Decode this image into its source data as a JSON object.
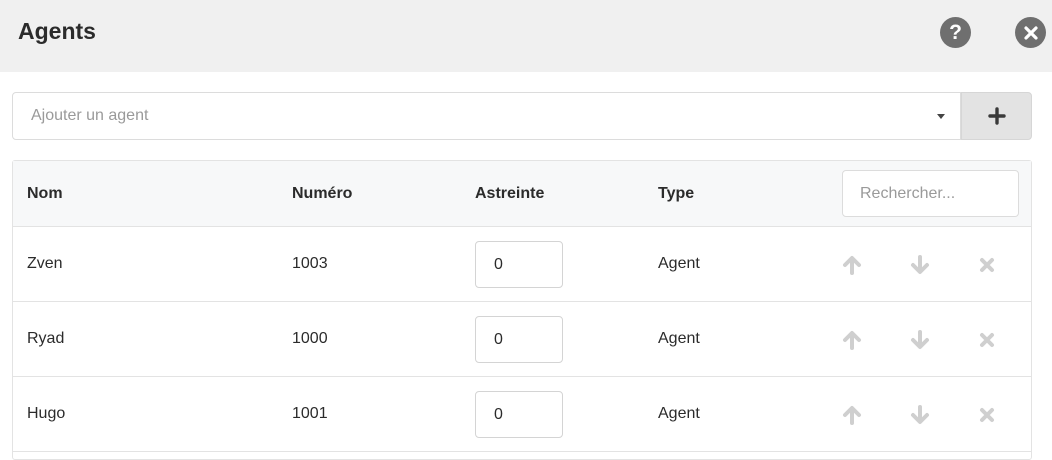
{
  "header": {
    "title": "Agents",
    "help_glyph": "?"
  },
  "agent_select": {
    "placeholder": "Ajouter un agent"
  },
  "table": {
    "columns": {
      "name": "Nom",
      "number": "Numéro",
      "astreinte": "Astreinte",
      "type": "Type"
    },
    "search_placeholder": "Rechercher...",
    "rows": [
      {
        "name": "Zven",
        "number": "1003",
        "astreinte": "0",
        "type": "Agent"
      },
      {
        "name": "Ryad",
        "number": "1000",
        "astreinte": "0",
        "type": "Agent"
      },
      {
        "name": "Hugo",
        "number": "1001",
        "astreinte": "0",
        "type": "Agent"
      }
    ]
  },
  "colors": {
    "header_bg": "#f0f0f0",
    "icon_grey": "#6f6f6f",
    "disabled_action": "#cfcfcf"
  },
  "icons": [
    "help-icon",
    "close-icon",
    "plus-icon",
    "arrow-up-icon",
    "arrow-down-icon",
    "remove-icon"
  ]
}
